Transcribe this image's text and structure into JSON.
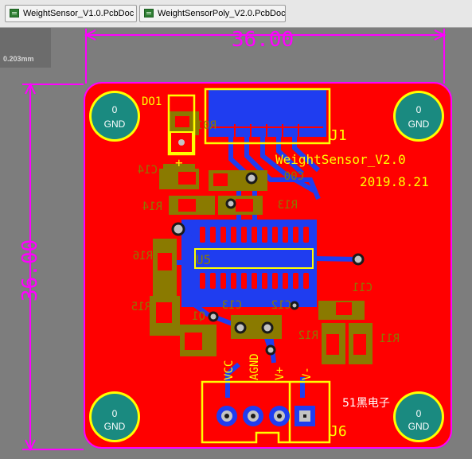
{
  "tabs": [
    {
      "label": "WeightSensor_V1.0.PcbDoc",
      "icon": "pcb-document-icon"
    },
    {
      "label": "WeightSensorPoly_V2.0.PcbDoc",
      "icon": "pcb-document-icon"
    }
  ],
  "info_overlay": {
    "text": "0.203mm"
  },
  "board": {
    "dim_horizontal": "36.00",
    "dim_vertical": "36.00",
    "title": "WeightSensor_V2.0",
    "date": "2019.8.21",
    "watermark": "51黑电子"
  },
  "holes": [
    {
      "top": "0",
      "bottom": "GND"
    },
    {
      "top": "0",
      "bottom": "GND"
    },
    {
      "top": "0",
      "bottom": "GND"
    },
    {
      "top": "0",
      "bottom": "GND"
    }
  ],
  "designators": {
    "d01": "DO1",
    "j1": "J1",
    "j6": "J6",
    "u5": "U5",
    "c14": "C14",
    "r14": "R14",
    "r13": "R13",
    "c00": "C00",
    "r16": "R16",
    "r15": "R15",
    "q1": "Q1",
    "c13": "C13",
    "c12": "C12",
    "c11": "C11",
    "r12": "R12",
    "r11": "R11",
    "r01": "R01",
    "plus": "+"
  },
  "pin_labels": [
    "VCC",
    "AGND",
    "V+",
    "V-"
  ],
  "colors": {
    "board": "#ff0000",
    "copper_bottom": "#1f3df0",
    "silkscreen": "#ffff00",
    "overlay": "#8a7a00",
    "dimension": "#ff00ff",
    "pad": "#c4c4c4",
    "hole_ring": "#1a8a80"
  }
}
